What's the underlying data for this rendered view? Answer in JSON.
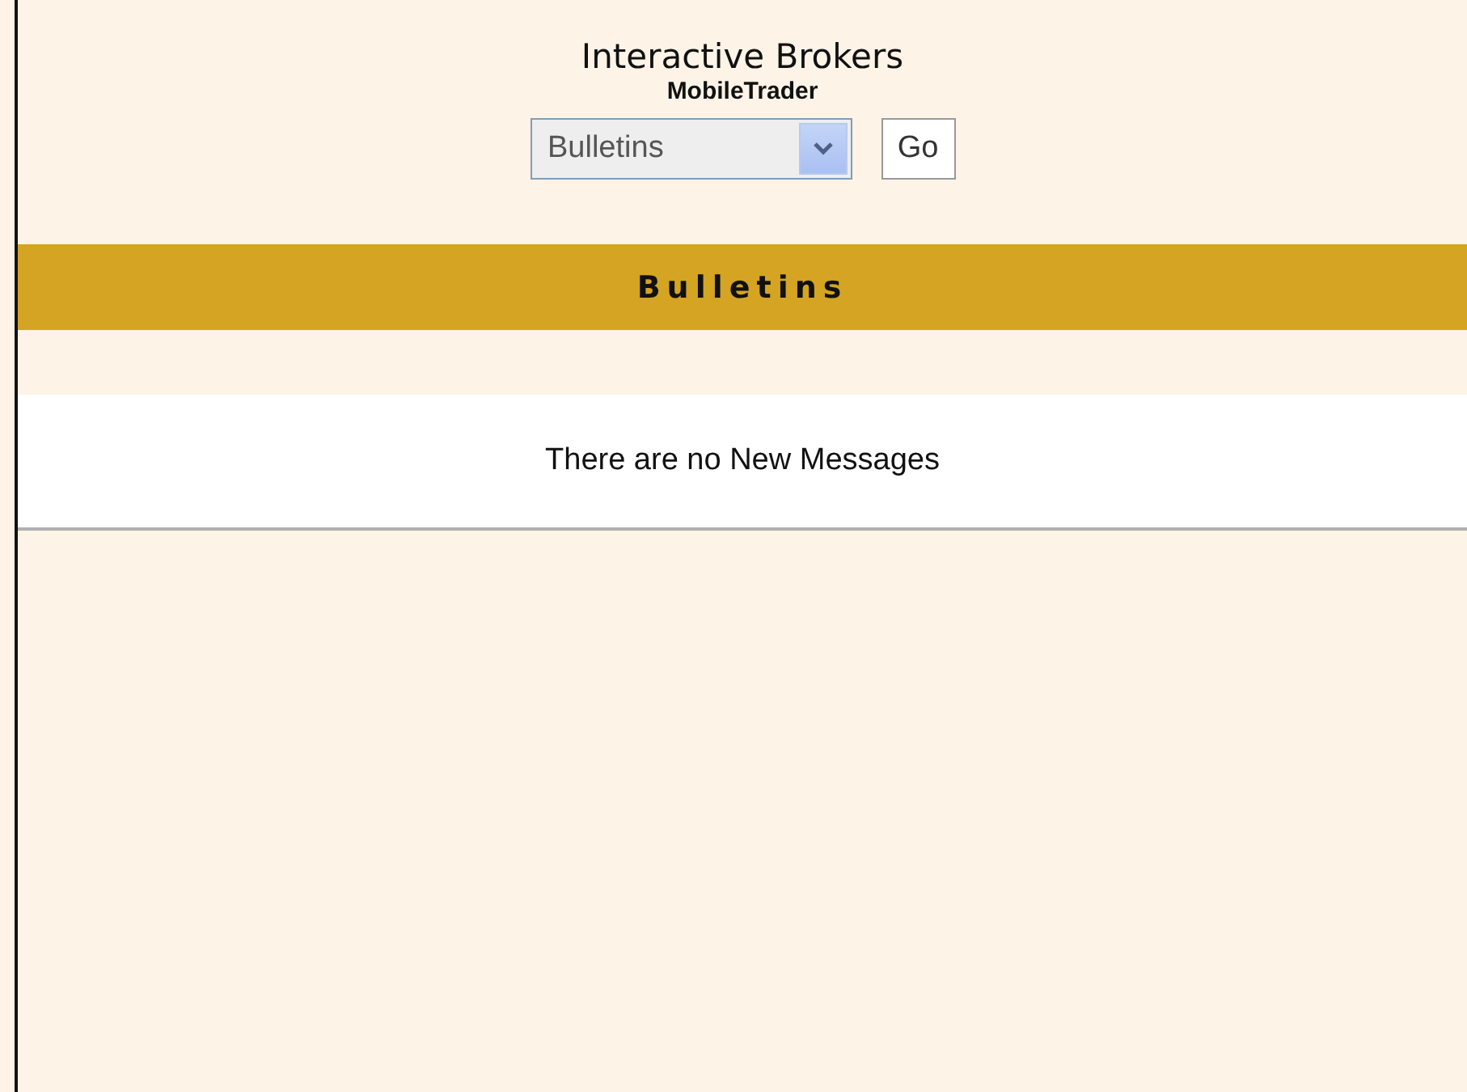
{
  "header": {
    "title": "Interactive Brokers",
    "subtitle": "MobileTrader"
  },
  "nav": {
    "dropdown": {
      "value": "Bulletins"
    },
    "go_button": "Go"
  },
  "section": {
    "title": "Bulletins"
  },
  "message": "There are no New Messages"
}
